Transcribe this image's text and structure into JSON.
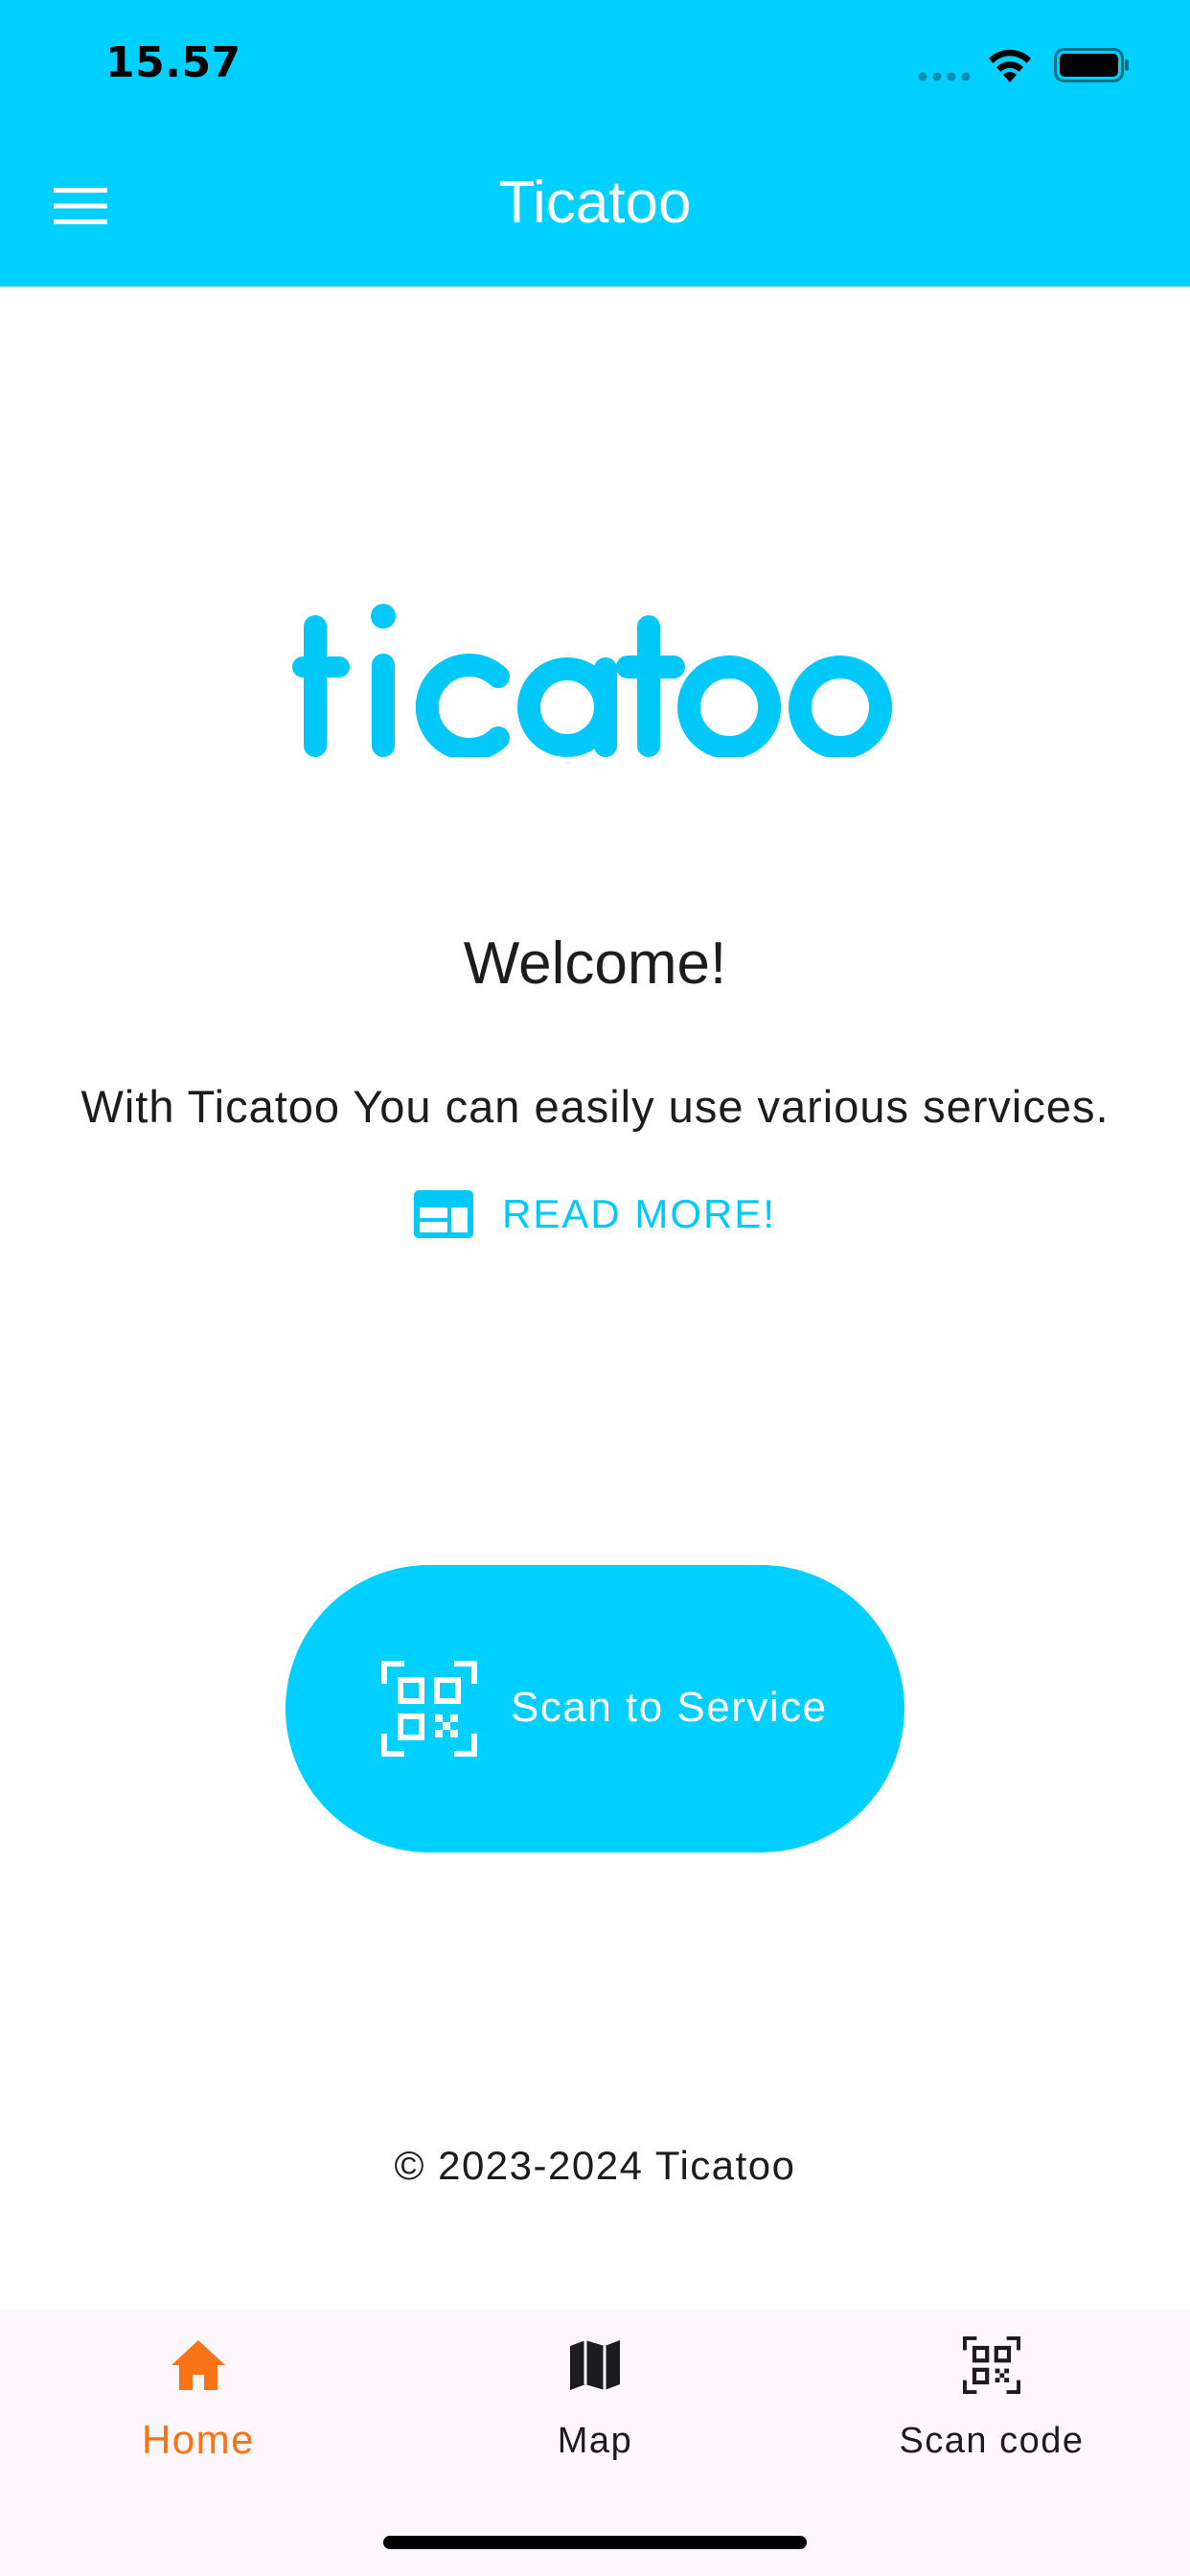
{
  "status_bar": {
    "time": "15.57"
  },
  "app_bar": {
    "title": "Ticatoo",
    "menu_icon": "hamburger-menu-icon"
  },
  "logo": {
    "text": "ticatoo",
    "color": "#00c8f8"
  },
  "main": {
    "welcome": "Welcome!",
    "subtitle": "With Ticatoo You can easily use various services.",
    "read_more_label": "READ MORE!",
    "read_more_icon": "article-icon",
    "scan_button_label": "Scan to Service",
    "scan_button_icon": "qr-code-icon",
    "copyright": "© 2023-2024 Ticatoo"
  },
  "bottom_nav": {
    "items": [
      {
        "label": "Home",
        "icon": "home-icon",
        "active": true
      },
      {
        "label": "Map",
        "icon": "map-icon",
        "active": false
      },
      {
        "label": "Scan code",
        "icon": "qr-code-icon",
        "active": false
      }
    ]
  },
  "colors": {
    "primary": "#00d0ff",
    "accent_active": "#f77316",
    "text": "#1c1c1e",
    "nav_background": "#fdf6fd"
  }
}
